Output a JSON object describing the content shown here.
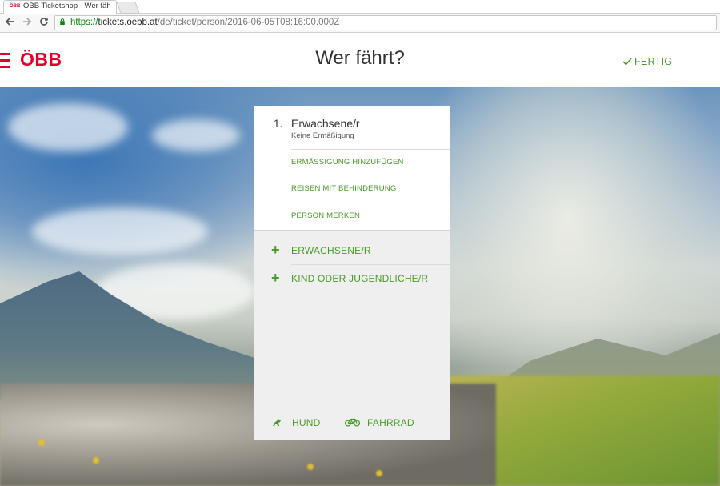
{
  "browser": {
    "tab_title": "ÖBB Ticketshop - Wer fäh",
    "tab_favicon": "ÖBB",
    "url_scheme": "https://",
    "url_host": "tickets.oebb.at",
    "url_path": "/de/ticket/person/2016-06-05T08:16:00.000Z"
  },
  "header": {
    "logo_text": "ÖBB",
    "title": "Wer fährt?",
    "done_label": "FERTIG"
  },
  "passenger": {
    "number": "1.",
    "type": "Erwachsene/r",
    "discount": "Keine Ermäßigung",
    "actions": [
      "ERMÄSSIGUNG HINZUFÜGEN",
      "REISEN MIT BEHINDERUNG",
      "PERSON MERKEN"
    ]
  },
  "add_options": [
    "ERWACHSENE/R",
    "KIND ODER JUGENDLICHE/R"
  ],
  "extras": {
    "dog_label": "HUND",
    "bike_label": "FAHRRAD"
  },
  "colors": {
    "brand_red": "#e2002a",
    "accent_green": "#4a9a2a"
  },
  "icons": [
    "back-arrow-icon",
    "forward-arrow-icon",
    "reload-icon",
    "lock-icon",
    "checkmark-icon",
    "plus-icon",
    "dog-icon",
    "bicycle-icon"
  ]
}
